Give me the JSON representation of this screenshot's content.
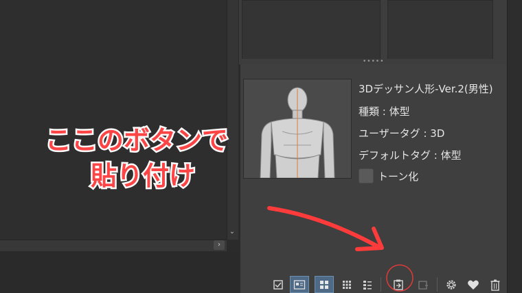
{
  "material": {
    "name": "3Dデッサン人形-Ver.2(男性)",
    "type_line": "種類 : 体型",
    "user_tag_line": "ユーザータグ : 3D",
    "default_tag_line": "デフォルトタグ : 体型"
  },
  "options": {
    "tone_label": "トーン化",
    "tone_checked": false
  },
  "annotation": {
    "line1": "ここのボタンで",
    "line2": "貼り付け",
    "color": "#ff4545"
  },
  "splitter": {
    "dots": "•••••"
  },
  "toolbar": {
    "icons": [
      "checkbox-icon",
      "detail-view-icon",
      "large-thumbnail-icon",
      "small-thumbnail-icon",
      "list-view-icon",
      "paste-to-canvas-icon",
      "replace-icon",
      "settings-icon",
      "favorite-icon",
      "delete-icon"
    ]
  },
  "colors": {
    "panel": "#3f3f3f",
    "canvas": "#2e2e2e",
    "selected": "#4f6a86",
    "highlight_circle": "#e03a3a"
  }
}
